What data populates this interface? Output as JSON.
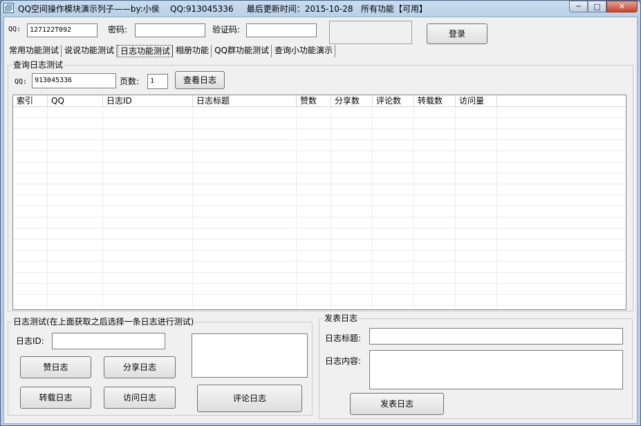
{
  "window": {
    "title": "QQ空间操作模块演示列子——by:小侯    QQ:913045336     最后更新时间：2015-10-28   所有功能【可用】",
    "minimize_glyph": "─",
    "maximize_glyph": "□",
    "close_glyph": "✕"
  },
  "login": {
    "qq_label": "QQ:",
    "qq_value": "127122T092",
    "password_label": "密码:",
    "password_value": "",
    "captcha_label": "验证码:",
    "captcha_value": "",
    "login_button": "登录"
  },
  "tabs": [
    {
      "label": "常用功能测试",
      "active": false
    },
    {
      "label": "说说功能测试",
      "active": false
    },
    {
      "label": "日志功能测试",
      "active": true
    },
    {
      "label": "相册功能",
      "active": false
    },
    {
      "label": "QQ群功能测试",
      "active": false
    },
    {
      "label": "查询小功能演示",
      "active": false
    }
  ],
  "query": {
    "group_title": "查询日志测试",
    "qq_label": "QQ:",
    "qq_value": "913045336",
    "page_label": "页数:",
    "page_value": "1",
    "view_button": "查看日志",
    "columns": [
      "索引",
      "QQ",
      "日志ID",
      "日志标题",
      "赞数",
      "分享数",
      "评论数",
      "转载数",
      "访问量"
    ]
  },
  "test": {
    "group_title": "日志测试(在上面获取之后选择一条日志进行测试)",
    "id_label": "日志ID:",
    "id_value": "",
    "like_button": "赞日志",
    "share_button": "分享日志",
    "repost_button": "转载日志",
    "visit_button": "访问日志",
    "comment_button": "评论日志",
    "comment_text": ""
  },
  "publish": {
    "group_title": "发表日志",
    "title_label": "日志标题:",
    "title_value": "",
    "content_label": "日志内容:",
    "content_value": "",
    "publish_button": "发表日志"
  }
}
